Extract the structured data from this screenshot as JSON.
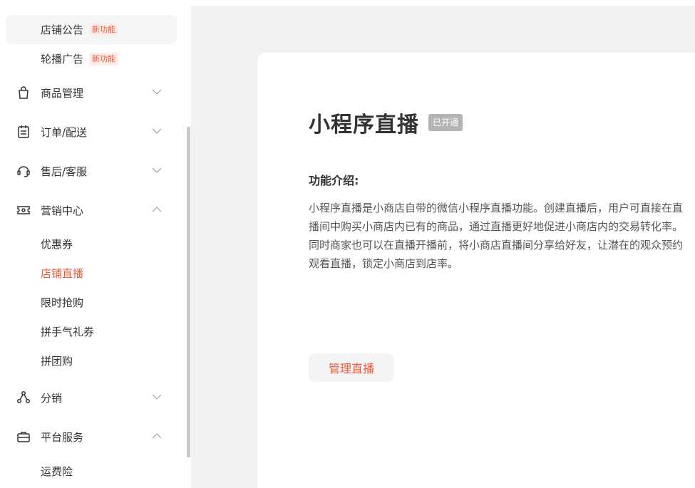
{
  "sidebar": {
    "top_items": [
      {
        "label": "店铺公告",
        "tag": "新功能"
      },
      {
        "label": "轮播广告",
        "tag": "新功能"
      }
    ],
    "groups": {
      "goods": {
        "label": "商品管理"
      },
      "orders": {
        "label": "订单/配送"
      },
      "aftersale": {
        "label": "售后/客服"
      },
      "marketing": {
        "label": "营销中心"
      },
      "distribution": {
        "label": "分销"
      },
      "platform": {
        "label": "平台服务"
      }
    },
    "marketing_items": [
      "优惠券",
      "店铺直播",
      "限时抢购",
      "拼手气礼券",
      "拼团购"
    ],
    "platform_items": [
      "运费险"
    ]
  },
  "main": {
    "title": "小程序直播",
    "status": "已开通",
    "intro_heading": "功能介绍:",
    "intro_text": "小程序直播是小商店自带的微信小程序直播功能。创建直播后，用户可直接在直播间中购买小商店内已有的商品，通过直播更好地促进小商店内的交易转化率。同时商家也可以在直播开播前，将小商店直播间分享给好友，让潜在的观众预约观看直播，锁定小商店到店率。",
    "manage_button": "管理直播"
  },
  "colors": {
    "accent": "#ee5a3a",
    "background": "#f2f2f3",
    "status_badge": "#b4b4b4"
  }
}
